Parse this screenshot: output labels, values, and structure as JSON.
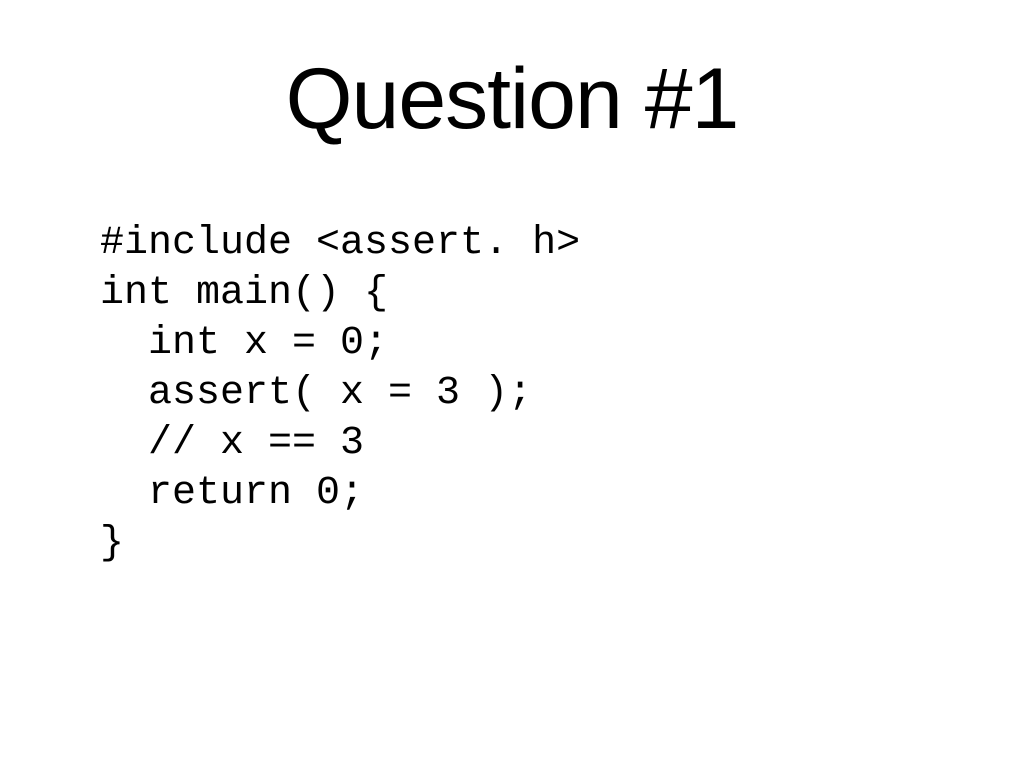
{
  "slide": {
    "title": "Question #1",
    "code": "#include <assert. h>\nint main() {\n  int x = 0;\n  assert( x = 3 );\n  // x == 3\n  return 0;\n}"
  }
}
